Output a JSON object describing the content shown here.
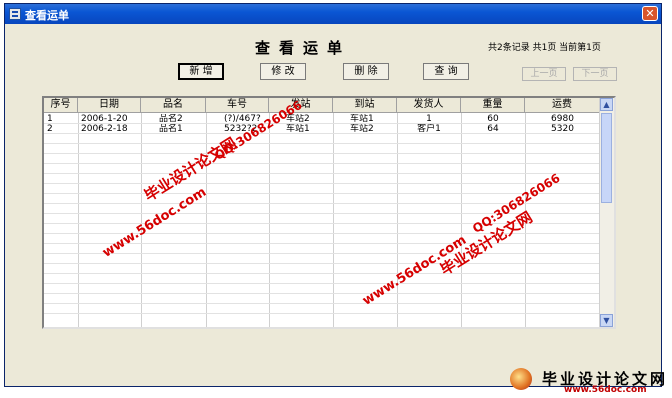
{
  "window": {
    "title": "查看运单",
    "close_glyph": "✕"
  },
  "header": {
    "title": "查看运单",
    "record_info": "共2条记录 共1页 当前第1页"
  },
  "toolbar": {
    "add_label": "新 增",
    "edit_label": "修 改",
    "delete_label": "删 除",
    "query_label": "查 询",
    "prev_label": "上一页",
    "next_label": "下一页"
  },
  "table": {
    "columns": [
      "序号",
      "日期",
      "品名",
      "车号",
      "发站",
      "到站",
      "发货人",
      "重量",
      "运费"
    ],
    "rows": [
      [
        "1",
        "2006-1-20",
        "品名2",
        "(?)/467?",
        "车站2",
        "车站1",
        "1",
        "60",
        "6980"
      ],
      [
        "2",
        "2006-2-18",
        "品名1",
        "5232?2",
        "车站1",
        "车站2",
        "客户1",
        "64",
        "5320"
      ]
    ]
  },
  "scrollbar": {
    "up_glyph": "▲",
    "down_glyph": "▼"
  },
  "watermarks": {
    "site_cn": "毕业设计论文网",
    "qq": "QQ:306826066",
    "url": "www.56doc.com"
  },
  "footer_logo": {
    "text": "毕业设计论文网",
    "url": "www.56doc.com"
  },
  "colors": {
    "titlebar": "#0a56d4",
    "dialog_bg": "#ece9d8",
    "watermark": "#d60000"
  }
}
